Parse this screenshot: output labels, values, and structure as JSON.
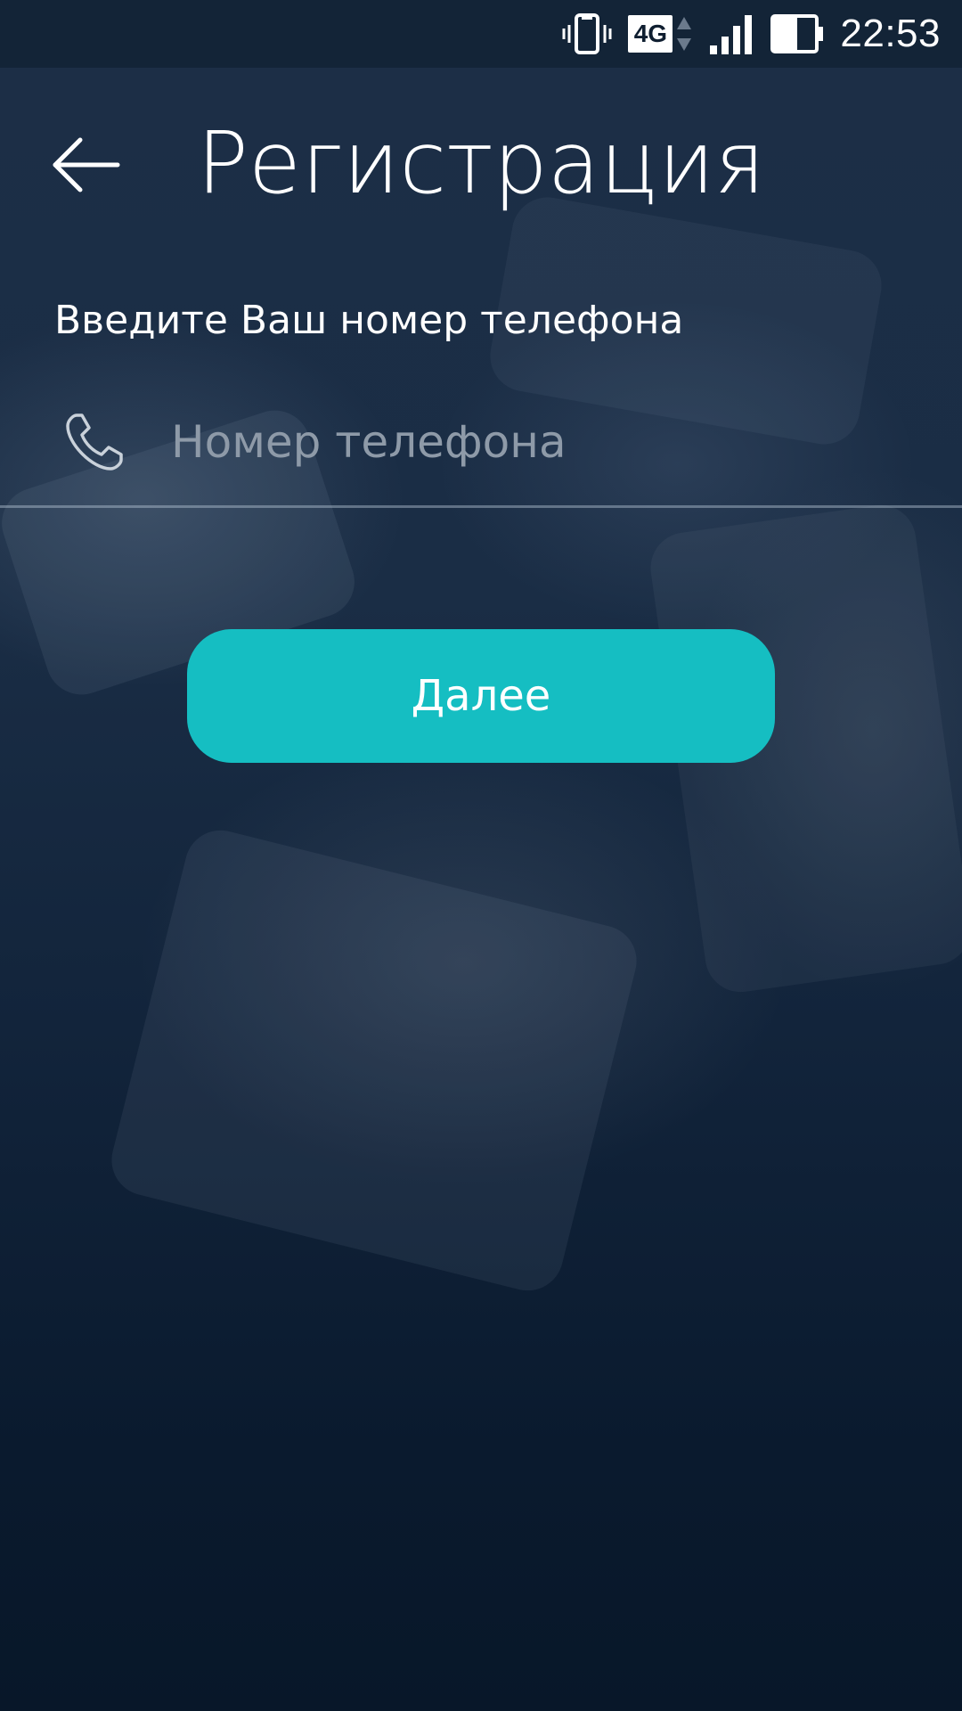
{
  "status_bar": {
    "time": "22:53",
    "network_label": "4G",
    "icons": [
      "vibrate-icon",
      "network-4g-icon",
      "signal-icon",
      "battery-icon"
    ]
  },
  "header": {
    "title": "Регистрация",
    "back_icon": "arrow-left-icon"
  },
  "form": {
    "prompt": "Введите Ваш номер телефона",
    "phone_placeholder": "Номер телефона",
    "phone_value": "",
    "phone_icon": "phone-icon"
  },
  "actions": {
    "next_label": "Далее"
  },
  "colors": {
    "accent": "#15bec2",
    "background": "#0b1c31",
    "placeholder": "#8e9aa8"
  }
}
